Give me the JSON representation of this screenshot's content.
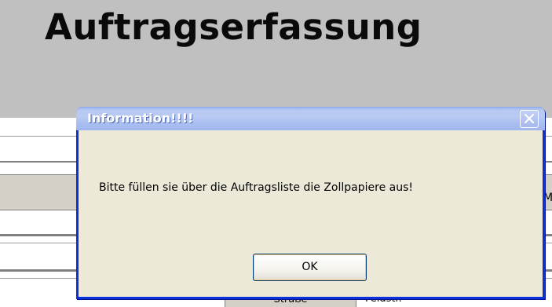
{
  "app": {
    "title": "Auftragserfassung"
  },
  "background": {
    "field_label": "Straße",
    "field_value": "Feldstr."
  },
  "dialog": {
    "title": "Information!!!!",
    "message": "Bitte füllen sie über die Auftragsliste die Zollpapiere aus!",
    "ok_label": "OK",
    "close_icon": "close-icon"
  },
  "colors": {
    "window_background": "#c0c0c0",
    "dialog_background": "#ece9d8",
    "titlebar_start": "#8aa6ea",
    "titlebar_end": "#9fb6ee",
    "border_blue": "#0831d9"
  }
}
